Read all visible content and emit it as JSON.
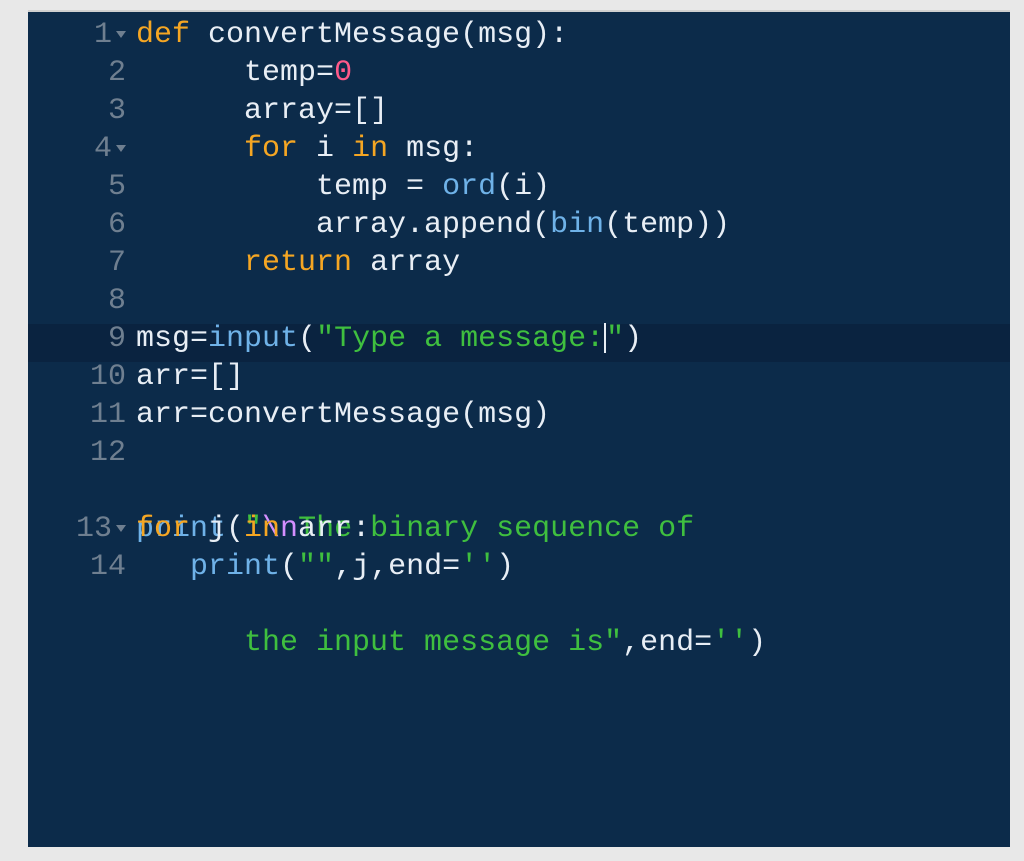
{
  "editor": {
    "gutter": [
      {
        "n": "1",
        "fold": true
      },
      {
        "n": "2",
        "fold": false
      },
      {
        "n": "3",
        "fold": false
      },
      {
        "n": "4",
        "fold": true
      },
      {
        "n": "5",
        "fold": false
      },
      {
        "n": "6",
        "fold": false
      },
      {
        "n": "7",
        "fold": false
      },
      {
        "n": "8",
        "fold": false
      },
      {
        "n": "9",
        "fold": false
      },
      {
        "n": "10",
        "fold": false
      },
      {
        "n": "11",
        "fold": false
      },
      {
        "n": "12",
        "fold": false
      },
      {
        "n": "",
        "fold": false
      },
      {
        "n": "13",
        "fold": true
      },
      {
        "n": "14",
        "fold": false
      }
    ],
    "tokens": {
      "l1": {
        "kw_def": "def ",
        "fn": "convertMessage",
        "open": "(",
        "arg": "msg",
        "close": "):"
      },
      "l2": {
        "indent": "      ",
        "var": "temp",
        "eq": "=",
        "zero": "0"
      },
      "l3": {
        "indent": "      ",
        "var": "array",
        "eq": "=[]"
      },
      "l4": {
        "indent": "      ",
        "kw_for": "for ",
        "i": "i",
        "kw_in": " in ",
        "msg": "msg",
        "colon": ":"
      },
      "l5": {
        "indent": "          ",
        "var": "temp ",
        "eq": "= ",
        "ord": "ord",
        "open": "(",
        "i": "i",
        "close": ")"
      },
      "l6": {
        "indent": "          ",
        "arr": "array.append(",
        "bin": "bin",
        "open": "(",
        "t": "temp",
        "close": "))"
      },
      "l7": {
        "indent": "      ",
        "kw_return": "return ",
        "arr": "array"
      },
      "l8": {
        "blank": " "
      },
      "l9": {
        "msg": "msg",
        "eq": "=",
        "input": "input",
        "open": "(",
        "str1": "\"Type a message:",
        "str2": "\"",
        "close": ")"
      },
      "l10": {
        "arr": "arr",
        "eq": "=[]"
      },
      "l11": {
        "arr": "arr",
        "eq": "=",
        "fn": "convertMessage(msg)"
      },
      "l12a": {
        "print": "print",
        "open": "(",
        "q": "\"",
        "esc": "\\n",
        "s1": "The binary sequence of "
      },
      "l12b": {
        "indent": "      ",
        "s2": "the input message is\"",
        "comma": ",",
        "end": "end",
        "eq": "=",
        "q": "''",
        "close": ")"
      },
      "l13": {
        "kw_for": "for ",
        "j": "j",
        "kw_in": " in ",
        "arr": "arr",
        "colon": ":"
      },
      "l14": {
        "indent": "   ",
        "print": "print",
        "open": "(",
        "q1": "\"\"",
        "c1": ",",
        "j": "j",
        "c2": ",",
        "end": "end",
        "eq": "=",
        "q2": "''",
        "close": ")"
      }
    },
    "highlight_line_index": 8
  }
}
